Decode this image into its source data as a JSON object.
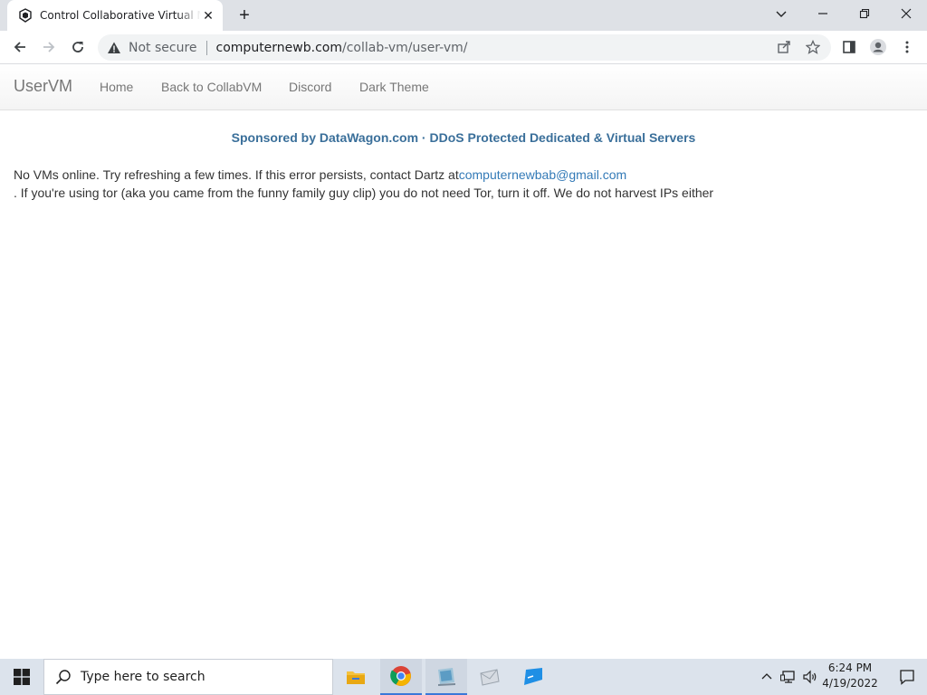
{
  "browser": {
    "tab_title": "Control Collaborative Virtual Machines",
    "security_label": "Not secure",
    "url_domain": "computernewb.com",
    "url_path": "/collab-vm/user-vm/"
  },
  "navbar": {
    "brand": "UserVM",
    "links": [
      "Home",
      "Back to CollabVM",
      "Discord",
      "Dark Theme"
    ]
  },
  "content": {
    "sponsor": "Sponsored by DataWagon.com · DDoS Protected Dedicated & Virtual Servers",
    "message_prefix": "No VMs online. Try refreshing a few times. If this error persists, contact Dartz at",
    "email": "computernewbab@gmail.com",
    "message_suffix": ". If you're using tor (aka you came from the funny family guy clip) you do not need Tor, turn it off. We do not harvest IPs either"
  },
  "taskbar": {
    "search_placeholder": "Type here to search",
    "time": "6:24 PM",
    "date": "4/19/2022"
  },
  "colors": {
    "link": "#337ab7",
    "sponsor": "#3a6f9a",
    "taskbar_bg": "#dce3ec"
  }
}
